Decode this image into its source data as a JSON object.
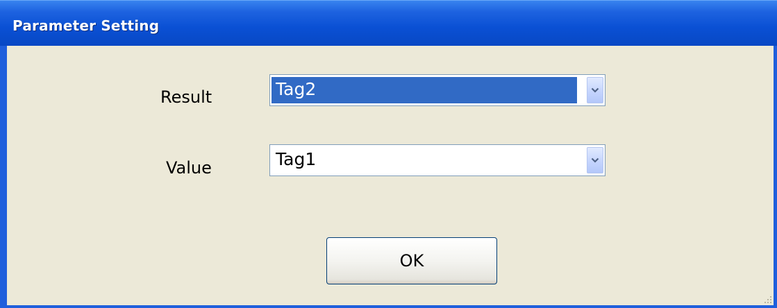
{
  "window": {
    "title": "Parameter Setting"
  },
  "form": {
    "result_label": "Result",
    "result_value": "Tag2",
    "value_label": "Value",
    "value_value": "Tag1"
  },
  "buttons": {
    "ok_label": "OK"
  },
  "icons": {
    "dropdown": "chevron-down-icon",
    "resize": "resize-grip-icon"
  },
  "colors": {
    "titlebar": "#0a50d4",
    "client_bg": "#ece9d8",
    "selection": "#316ac5"
  }
}
